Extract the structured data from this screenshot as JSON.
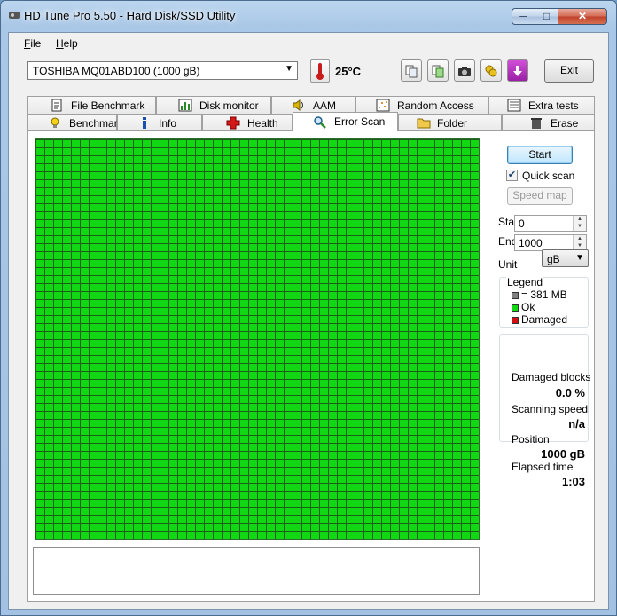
{
  "window": {
    "title": "HD Tune Pro 5.50 - Hard Disk/SSD Utility",
    "controls": {
      "minimize": "─",
      "maximize": "□",
      "close": "✕"
    }
  },
  "menu": [
    {
      "label": "File",
      "accel": "F",
      "rest": "ile"
    },
    {
      "label": "Help",
      "accel": "H",
      "rest": "elp"
    }
  ],
  "toolbar": {
    "drive": "TOSHIBA MQ01ABD100 (1000 gB)",
    "temperature": "25°C",
    "exit_label": "Exit"
  },
  "tabs_top": [
    {
      "label": "File Benchmark",
      "icon": "file-benchmark-icon"
    },
    {
      "label": "Disk monitor",
      "icon": "disk-monitor-icon"
    },
    {
      "label": "AAM",
      "icon": "speaker-icon"
    },
    {
      "label": "Random Access",
      "icon": "random-access-icon"
    },
    {
      "label": "Extra tests",
      "icon": "extra-tests-icon"
    }
  ],
  "tabs_bottom": [
    {
      "label": "Benchmark",
      "icon": "lightbulb-icon"
    },
    {
      "label": "Info",
      "icon": "info-icon"
    },
    {
      "label": "Health",
      "icon": "health-cross-icon"
    },
    {
      "label": "Error Scan",
      "icon": "magnifier-icon",
      "active": true
    },
    {
      "label": "Folder Usage",
      "icon": "folder-icon"
    },
    {
      "label": "Erase",
      "icon": "trash-icon"
    }
  ],
  "scan": {
    "start_label": "Start",
    "quick_scan_label": "Quick scan",
    "quick_scan_checked": true,
    "speed_map_label": "Speed map",
    "start_field_label": "Start",
    "start_value": "0",
    "end_field_label": "End",
    "end_value": "1000",
    "unit_label": "Unit",
    "unit_value": "gB"
  },
  "legend": {
    "title": "Legend",
    "items": [
      {
        "label": "= 381 MB",
        "color": "#808080"
      },
      {
        "label": "Ok",
        "color": "#11d813"
      },
      {
        "label": "Damaged",
        "color": "#d01010"
      }
    ]
  },
  "stats": {
    "damaged_blocks_label": "Damaged blocks",
    "damaged_blocks_value": "0.0 %",
    "scanning_speed_label": "Scanning speed",
    "scanning_speed_value": "n/a",
    "position_label": "Position",
    "position_value": "1000 gB",
    "elapsed_label": "Elapsed time",
    "elapsed_value": "1:03"
  },
  "colors": {
    "block_ok": "#11d813",
    "grid_line": "#1d5e1d"
  }
}
